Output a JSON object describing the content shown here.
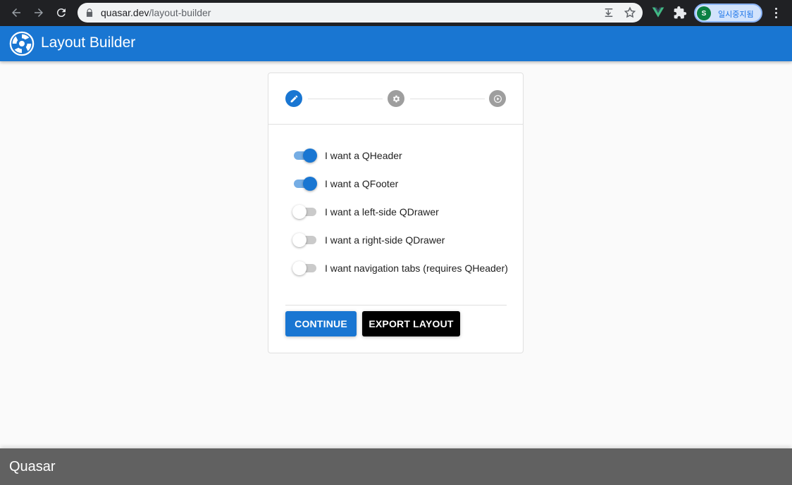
{
  "browser": {
    "url_host": "quasar.dev",
    "url_path": "/layout-builder",
    "profile_initial": "S",
    "profile_label": "일시중지됨"
  },
  "header": {
    "title": "Layout Builder"
  },
  "stepper": {
    "steps": [
      {
        "icon": "pencil-icon",
        "state": "active"
      },
      {
        "icon": "gear-icon",
        "state": "inactive"
      },
      {
        "icon": "play-circle-icon",
        "state": "inactive"
      }
    ]
  },
  "toggles": [
    {
      "label": "I want a QHeader",
      "checked": true
    },
    {
      "label": "I want a QFooter",
      "checked": true
    },
    {
      "label": "I want a left-side QDrawer",
      "checked": false
    },
    {
      "label": "I want a right-side QDrawer",
      "checked": false
    },
    {
      "label": "I want navigation tabs (requires QHeader)",
      "checked": false
    }
  ],
  "actions": {
    "continue_label": "CONTINUE",
    "export_label": "EXPORT LAYOUT"
  },
  "footer": {
    "title": "Quasar"
  },
  "colors": {
    "primary": "#1976d2",
    "footer": "#616161",
    "chrome": "#202124"
  }
}
